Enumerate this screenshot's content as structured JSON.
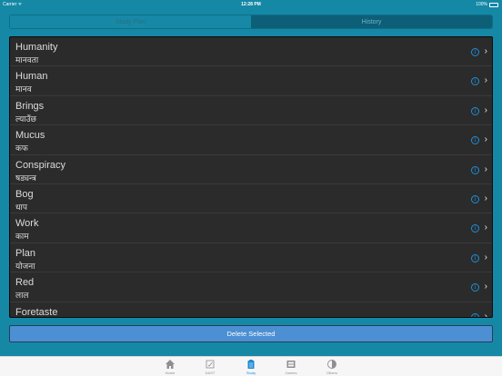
{
  "status_bar": {
    "carrier": "Carrier ᯤ",
    "time": "12:28 PM",
    "battery": "100%"
  },
  "segments": [
    {
      "label": "Study Plan",
      "active": true
    },
    {
      "label": "History",
      "active": false
    }
  ],
  "words": [
    {
      "word": "Humanity",
      "meaning": "मानवता"
    },
    {
      "word": "Human",
      "meaning": "मानव"
    },
    {
      "word": "Brings",
      "meaning": "ल्याउँछ"
    },
    {
      "word": "Mucus",
      "meaning": "कफ"
    },
    {
      "word": "Conspiracy",
      "meaning": "षड्यन्त्र"
    },
    {
      "word": "Bog",
      "meaning": "धाप"
    },
    {
      "word": "Work",
      "meaning": "काम"
    },
    {
      "word": "Plan",
      "meaning": "योजना"
    },
    {
      "word": "Red",
      "meaning": "लाल"
    },
    {
      "word": "Foretaste",
      "meaning": ""
    }
  ],
  "delete_label": "Delete Selected",
  "tabs": [
    {
      "label": "Home",
      "icon": "home-icon",
      "active": false
    },
    {
      "label": "DAST",
      "icon": "edit-icon",
      "active": false
    },
    {
      "label": "Study",
      "icon": "clipboard-icon",
      "active": true
    },
    {
      "label": "Games",
      "icon": "film-icon",
      "active": false
    },
    {
      "label": "Others",
      "icon": "contrast-icon",
      "active": false
    }
  ],
  "colors": {
    "background": "#1588a6",
    "list_bg": "#2b2b2b",
    "accent": "#1e8ad6",
    "button": "#4c8fd3"
  }
}
